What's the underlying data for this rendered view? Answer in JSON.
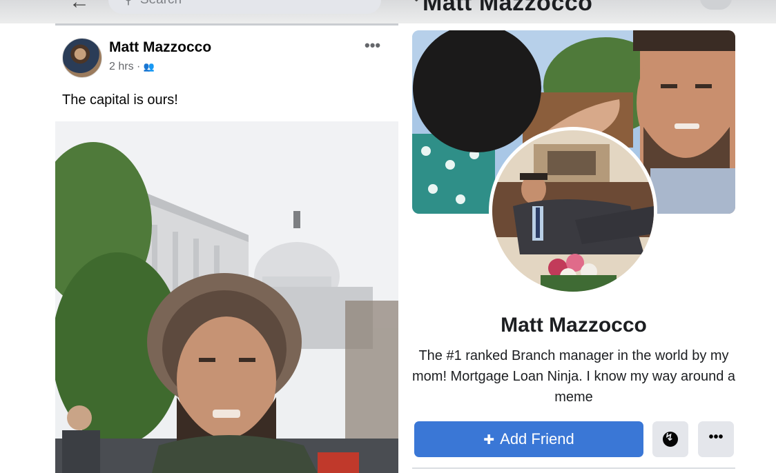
{
  "top_bar": {
    "back_icon": "arrow-left-icon",
    "search_placeholder": "Search",
    "search_icon": "search-icon",
    "profile_header_name": "Matt Mazzocco",
    "chevron_icon": "chevron-icon",
    "profile_search_icon": "search-icon"
  },
  "post": {
    "author": "Matt Mazzocco",
    "time": "2 hrs",
    "separator": "·",
    "audience_icon": "friends-icon",
    "menu_label": "•••",
    "text": "The capital is ours!"
  },
  "profile": {
    "name": "Matt Mazzocco",
    "bio": "The #1 ranked Branch manager in the world by my mom! Mortgage Loan Ninja. I know my way around a meme",
    "add_friend_label": "Add Friend",
    "add_friend_icon": "add-person-icon",
    "messenger_icon": "messenger-icon",
    "more_label": "•••"
  },
  "colors": {
    "primary_button": "#3a77d6",
    "secondary_button": "#e4e6eb",
    "meta_text": "#65676b"
  }
}
